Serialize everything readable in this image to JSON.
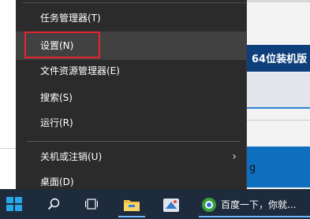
{
  "context_menu": {
    "items": [
      {
        "label": "任务管理器(T)"
      },
      {
        "label": "设置(N)"
      },
      {
        "label": "文件资源管理器(E)"
      },
      {
        "label": "搜索(S)"
      },
      {
        "label": "运行(R)"
      },
      {
        "label": "关机或注销(U)"
      },
      {
        "label": "桌面(D)"
      }
    ],
    "submenu_chevron": "›"
  },
  "background": {
    "banner_text": "64位装机版",
    "partial_text": "g"
  },
  "taskbar": {
    "browser_title": "百度一下，你就..."
  },
  "colors": {
    "menu_bg": "#2b2b2b",
    "hover_bg": "#414141",
    "highlight_border": "#e3262d",
    "taskbar_bg": "#1e2b3d",
    "start_icon": "#27a7e6"
  }
}
